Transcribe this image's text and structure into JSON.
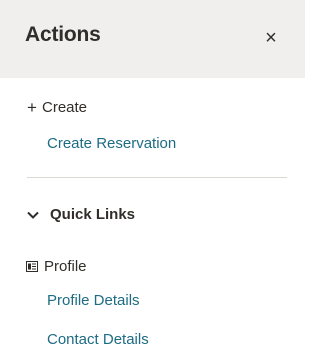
{
  "header": {
    "title": "Actions",
    "close_glyph": "×"
  },
  "create": {
    "heading": "Create",
    "icon": "plus-icon",
    "items": [
      "Create Reservation"
    ]
  },
  "quick_links": {
    "heading": "Quick Links",
    "icon": "chevron-down-icon",
    "profile": {
      "heading": "Profile",
      "icon": "profile-card-icon",
      "items": [
        "Profile Details",
        "Contact Details"
      ]
    }
  },
  "colors": {
    "header_bg": "#f1efed",
    "text": "#312d2a",
    "link": "#1d6c84",
    "divider": "#dcd9d5"
  }
}
